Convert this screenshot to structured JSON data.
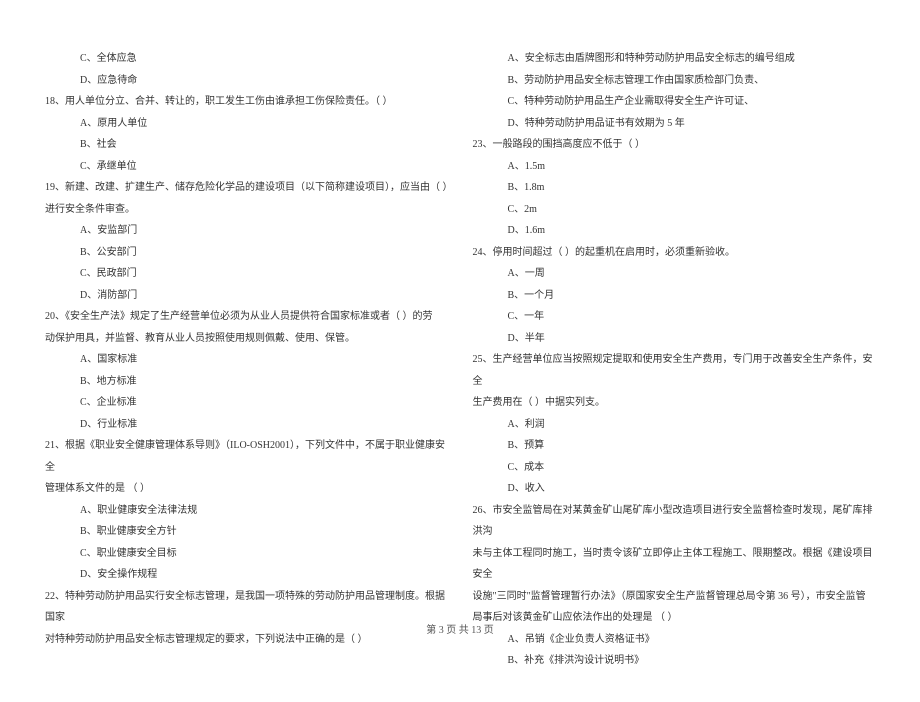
{
  "left": {
    "q17_opt_c": "C、全体应急",
    "q17_opt_d": "D、应急待命",
    "q18": "18、用人单位分立、合并、转让的，职工发生工伤由谁承担工伤保险责任。（    ）",
    "q18_opt_a": "A、原用人单位",
    "q18_opt_b": "B、社会",
    "q18_opt_c": "C、承继单位",
    "q19": "19、新建、改建、扩建生产、储存危险化学品的建设项目（以下简称建设项目），应当由（    ）",
    "q19_cont": "进行安全条件审查。",
    "q19_opt_a": "A、安监部门",
    "q19_opt_b": "B、公安部门",
    "q19_opt_c": "C、民政部门",
    "q19_opt_d": "D、消防部门",
    "q20": "20、《安全生产法》规定了生产经营单位必须为从业人员提供符合国家标准或者（    ）的劳",
    "q20_cont": "动保护用具，并监督、教育从业人员按照使用规则佩戴、使用、保管。",
    "q20_opt_a": "A、国家标准",
    "q20_opt_b": "B、地方标准",
    "q20_opt_c": "C、企业标准",
    "q20_opt_d": "D、行业标准",
    "q21": "21、根据《职业安全健康管理体系导则》（ILO-OSH2001），下列文件中，不属于职业健康安全",
    "q21_cont": "管理体系文件的是 （    ）",
    "q21_opt_a": "A、职业健康安全法律法规",
    "q21_opt_b": "B、职业健康安全方针",
    "q21_opt_c": "C、职业健康安全目标",
    "q21_opt_d": "D、安全操作规程",
    "q22": "22、特种劳动防护用品实行安全标志管理，是我国一项特殊的劳动防护用品管理制度。根据国家",
    "q22_cont": "对特种劳动防护用品安全标志管理规定的要求，下列说法中正确的是（    ）"
  },
  "right": {
    "q22_opt_a": "A、安全标志由盾牌图形和特种劳动防护用品安全标志的编号组成",
    "q22_opt_b": "B、劳动防护用品安全标志管理工作由国家质检部门负责、",
    "q22_opt_c": "C、特种劳动防护用品生产企业需取得安全生产许可证、",
    "q22_opt_d": "D、特种劳动防护用品证书有效期为 5 年",
    "q23": "23、一般路段的围挡高度应不低于（    ）",
    "q23_opt_a": "A、1.5m",
    "q23_opt_b": "B、1.8m",
    "q23_opt_c": "C、2m",
    "q23_opt_d": "D、1.6m",
    "q24": "24、停用时间超过（    ）的起重机在启用时，必须重新验收。",
    "q24_opt_a": "A、一周",
    "q24_opt_b": "B、一个月",
    "q24_opt_c": "C、一年",
    "q24_opt_d": "D、半年",
    "q25": "25、生产经营单位应当按照规定提取和使用安全生产费用，专门用于改善安全生产条件，安全",
    "q25_cont": "生产费用在（    ）中据实列支。",
    "q25_opt_a": "A、利润",
    "q25_opt_b": "B、预算",
    "q25_opt_c": "C、成本",
    "q25_opt_d": "D、收入",
    "q26": "26、市安全监管局在对某黄金矿山尾矿库小型改造项目进行安全监督检查时发现，尾矿库排洪沟",
    "q26_cont1": "未与主体工程同时施工，当时责令该矿立即停止主体工程施工、限期整改。根据《建设项目安全",
    "q26_cont2": "设施\"三同时\"监督管理暂行办法》（原国家安全生产监督管理总局令第 36 号），市安全监管",
    "q26_cont3": "局事后对该黄金矿山应依法作出的处理是 （    ）",
    "q26_opt_a": "A、吊销《企业负责人资格证书》",
    "q26_opt_b": "B、补充《排洪沟设计说明书》"
  },
  "footer": "第 3 页 共 13 页"
}
